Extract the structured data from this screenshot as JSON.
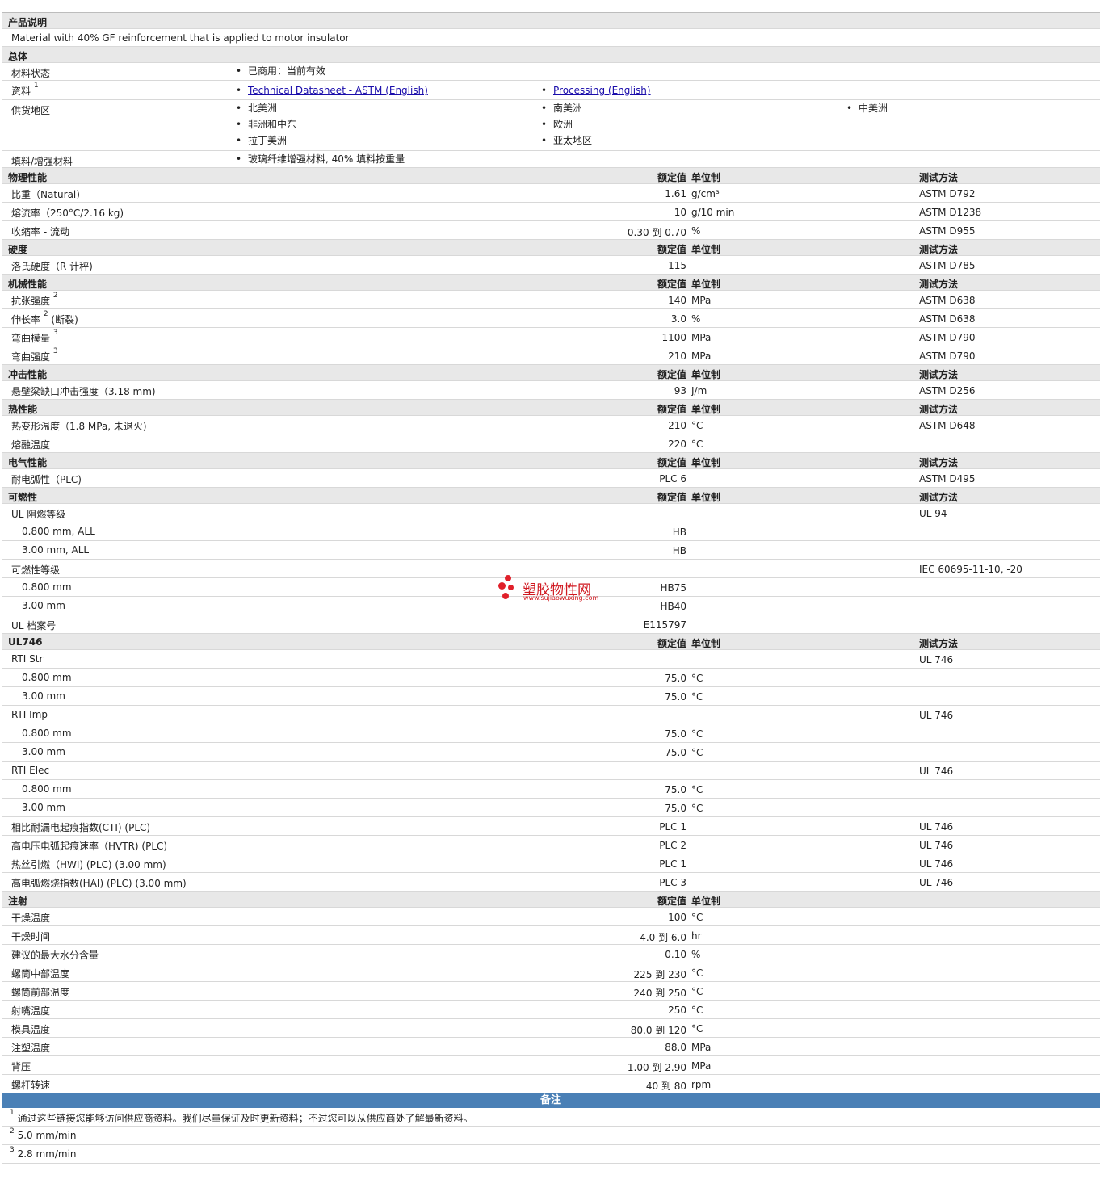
{
  "desc": {
    "title": "产品说明",
    "text": "Material with 40% GF reinforcement that is applied to motor insulator"
  },
  "general": {
    "title": "总体",
    "status_label": "材料状态",
    "status_value": "已商用：当前有效",
    "docs_label": "资料",
    "docs_sup": "1",
    "doc1": "Technical Datasheet - ASTM (English)",
    "doc2": "Processing (English)",
    "supply_label": "供货地区",
    "regions": [
      "北美洲",
      "非洲和中东",
      "拉丁美洲",
      "南美洲",
      "欧洲",
      "亚太地区",
      "中美洲"
    ],
    "filler_label": "填料/增强材料",
    "filler_value": "玻璃纤维增强材料, 40% 填料按重量"
  },
  "headers": {
    "value": "额定值",
    "unit": "单位制",
    "test": "测试方法"
  },
  "physical": {
    "title": "物理性能",
    "rows": [
      {
        "label": "比重（Natural)",
        "value": "1.61",
        "unit": "g/cm³",
        "test": "ASTM D792"
      },
      {
        "label": "熔流率（250°C/2.16 kg)",
        "value": "10",
        "unit": "g/10 min",
        "test": "ASTM D1238"
      },
      {
        "label": "收缩率 - 流动",
        "value": "0.30 到  0.70",
        "unit": "%",
        "test": "ASTM D955"
      }
    ]
  },
  "hardness": {
    "title": "硬度",
    "rows": [
      {
        "label": "洛氏硬度（R 计秤)",
        "value": "115",
        "unit": "",
        "test": "ASTM D785"
      }
    ]
  },
  "mechanical": {
    "title": "机械性能",
    "rows": [
      {
        "label": "抗张强度",
        "sup": "2",
        "label2": "",
        "value": "140",
        "unit": "MPa",
        "test": "ASTM D638"
      },
      {
        "label": "伸长率",
        "sup": "2",
        "label2": "(断裂)",
        "value": "3.0",
        "unit": "%",
        "test": "ASTM D638"
      },
      {
        "label": "弯曲模量",
        "sup": "3",
        "label2": "",
        "value": "1100",
        "unit": "MPa",
        "test": "ASTM D790"
      },
      {
        "label": "弯曲强度",
        "sup": "3",
        "label2": "",
        "value": "210",
        "unit": "MPa",
        "test": "ASTM D790"
      }
    ]
  },
  "impact": {
    "title": "冲击性能",
    "rows": [
      {
        "label": "悬壁梁缺口冲击强度（3.18 mm)",
        "value": "93",
        "unit": "J/m",
        "test": "ASTM D256"
      }
    ]
  },
  "thermal": {
    "title": "热性能",
    "rows": [
      {
        "label": "热变形温度（1.8 MPa, 未退火)",
        "value": "210",
        "unit": "°C",
        "test": "ASTM D648"
      },
      {
        "label": "熔融温度",
        "value": "220",
        "unit": "°C",
        "test": ""
      }
    ]
  },
  "electrical": {
    "title": "电气性能",
    "rows": [
      {
        "label": "耐电弧性（PLC)",
        "value": "PLC 6",
        "unit": "",
        "test": "ASTM D495"
      }
    ]
  },
  "flamm": {
    "title": "可燃性",
    "rows": [
      {
        "label": "UL 阻燃等级",
        "ind": false,
        "value": "",
        "unit": "",
        "test": "UL 94"
      },
      {
        "label": "0.800 mm, ALL",
        "ind": true,
        "value": "HB",
        "unit": "",
        "test": ""
      },
      {
        "label": "3.00 mm, ALL",
        "ind": true,
        "value": "HB",
        "unit": "",
        "test": ""
      },
      {
        "label": "可燃性等级",
        "ind": false,
        "value": "",
        "unit": "",
        "test": "IEC 60695-11-10, -20"
      },
      {
        "label": "0.800 mm",
        "ind": true,
        "value": "HB75",
        "unit": "",
        "test": ""
      },
      {
        "label": "3.00 mm",
        "ind": true,
        "value": "HB40",
        "unit": "",
        "test": ""
      },
      {
        "label": "UL 档案号",
        "ind": false,
        "value": "E115797",
        "unit": "",
        "test": ""
      }
    ]
  },
  "ul746": {
    "title": "UL746",
    "rows": [
      {
        "label": "RTI Str",
        "ind": false,
        "value": "",
        "unit": "",
        "test": "UL 746"
      },
      {
        "label": "0.800 mm",
        "ind": true,
        "value": "75.0",
        "unit": "°C",
        "test": ""
      },
      {
        "label": "3.00 mm",
        "ind": true,
        "value": "75.0",
        "unit": "°C",
        "test": ""
      },
      {
        "label": "RTI Imp",
        "ind": false,
        "value": "",
        "unit": "",
        "test": "UL 746"
      },
      {
        "label": "0.800 mm",
        "ind": true,
        "value": "75.0",
        "unit": "°C",
        "test": ""
      },
      {
        "label": "3.00 mm",
        "ind": true,
        "value": "75.0",
        "unit": "°C",
        "test": ""
      },
      {
        "label": "RTI Elec",
        "ind": false,
        "value": "",
        "unit": "",
        "test": "UL 746"
      },
      {
        "label": "0.800 mm",
        "ind": true,
        "value": "75.0",
        "unit": "°C",
        "test": ""
      },
      {
        "label": "3.00 mm",
        "ind": true,
        "value": "75.0",
        "unit": "°C",
        "test": ""
      },
      {
        "label": "相比耐漏电起痕指数(CTI) (PLC)",
        "ind": false,
        "value": "PLC 1",
        "unit": "",
        "test": "UL 746"
      },
      {
        "label": "高电压电弧起痕速率（HVTR) (PLC)",
        "ind": false,
        "value": "PLC 2",
        "unit": "",
        "test": "UL 746"
      },
      {
        "label": "热丝引燃（HWI) (PLC) (3.00 mm)",
        "ind": false,
        "value": "PLC 1",
        "unit": "",
        "test": "UL 746"
      },
      {
        "label": "高电弧燃烧指数(HAI) (PLC) (3.00 mm)",
        "ind": false,
        "value": "PLC 3",
        "unit": "",
        "test": "UL 746"
      }
    ]
  },
  "injection": {
    "title": "注射",
    "rows": [
      {
        "label": "干燥温度",
        "value": "100",
        "unit": "°C"
      },
      {
        "label": "干燥时间",
        "value": "4.0 到  6.0",
        "unit": "hr"
      },
      {
        "label": "建议的最大水分含量",
        "value": "0.10",
        "unit": "%"
      },
      {
        "label": "螺筒中部温度",
        "value": "225 到  230",
        "unit": "°C"
      },
      {
        "label": "螺筒前部温度",
        "value": "240 到  250",
        "unit": "°C"
      },
      {
        "label": "射嘴温度",
        "value": "250",
        "unit": "°C"
      },
      {
        "label": "模具温度",
        "value": "80.0 到  120",
        "unit": "°C"
      },
      {
        "label": "注塑温度",
        "value": "88.0",
        "unit": "MPa"
      },
      {
        "label": "背压",
        "value": "1.00 到  2.90",
        "unit": "MPa"
      },
      {
        "label": "螺杆转速",
        "value": "40 到  80",
        "unit": "rpm"
      }
    ]
  },
  "notes": {
    "title": "备注",
    "items": [
      {
        "sup": "1",
        "text": "通过这些链接您能够访问供应商资料。我们尽量保证及时更新资料；不过您可以从供应商处了解最新资料。"
      },
      {
        "sup": "2",
        "text": "5.0 mm/min"
      },
      {
        "sup": "3",
        "text": "2.8 mm/min"
      }
    ]
  },
  "watermark": {
    "name": "塑胶物性网",
    "url": "www.sujiaowuxing.com"
  },
  "colors": {
    "section_bg": "#e8e8e8",
    "notes_header": "#4a80b6",
    "link": "#1a0dab",
    "watermark": "#e0202a"
  }
}
